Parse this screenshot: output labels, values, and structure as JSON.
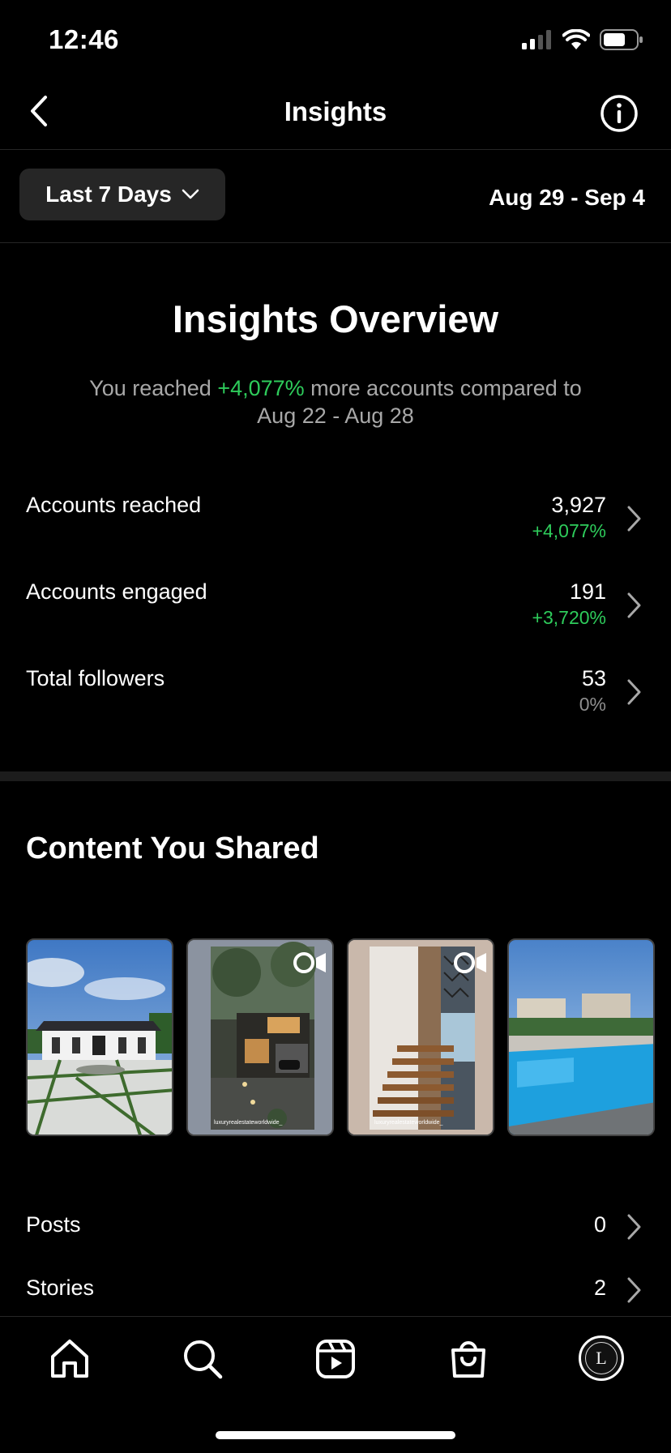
{
  "status_bar": {
    "time": "12:46"
  },
  "header": {
    "title": "Insights"
  },
  "filter": {
    "range_label": "Last 7 Days",
    "date_range": "Aug 29 - Sep 4"
  },
  "overview": {
    "title": "Insights Overview",
    "desc_prefix": "You reached ",
    "desc_highlight": "+4,077%",
    "desc_suffix": " more accounts compared to",
    "desc_line2": "Aug 22 - Aug 28"
  },
  "metrics": [
    {
      "label": "Accounts reached",
      "value": "3,927",
      "delta": "+4,077%",
      "delta_color": "#2ecc5b"
    },
    {
      "label": "Accounts engaged",
      "value": "191",
      "delta": "+3,720%",
      "delta_color": "#2ecc5b"
    },
    {
      "label": "Total followers",
      "value": "53",
      "delta": "0%",
      "delta_color": "#8e8e8e"
    }
  ],
  "content": {
    "title": "Content You Shared",
    "thumbnails": [
      {
        "kind": "post",
        "name": "white-villa-driveway"
      },
      {
        "kind": "reel",
        "name": "modern-house-night",
        "caption": "luxuryrealestateworldwide_"
      },
      {
        "kind": "reel",
        "name": "floating-staircase",
        "caption": "luxuryrealestateworldwide_"
      },
      {
        "kind": "post",
        "name": "pool-terrace"
      }
    ]
  },
  "summary": [
    {
      "label": "Posts",
      "value": "0"
    },
    {
      "label": "Stories",
      "value": "2"
    }
  ],
  "tabbar": {
    "items": [
      "home-icon",
      "search-icon",
      "reels-icon",
      "shop-icon",
      "profile-avatar"
    ],
    "avatar_letter": "L"
  },
  "colors": {
    "background": "#000000",
    "accent_green": "#2ecc5b",
    "button_bg": "#262626"
  }
}
